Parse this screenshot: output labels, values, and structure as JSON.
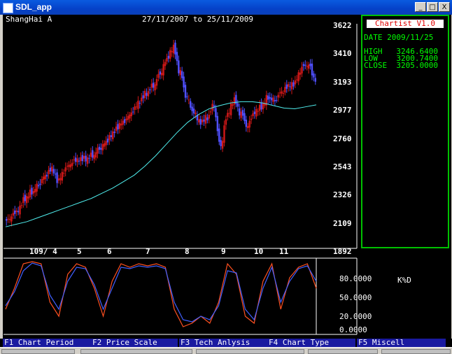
{
  "window": {
    "title": "SDL_app",
    "buttons": {
      "minimize": "_",
      "maximize": "□",
      "close": "X"
    }
  },
  "chart_header": {
    "symbol": "ShangHai A",
    "date_range": "27/11/2007 to 25/11/2009"
  },
  "info_panel": {
    "app_name": "Chartist V1.0",
    "date": "DATE 2009/11/25",
    "high": "HIGH   3246.6400",
    "low": "LOW    3200.7400",
    "close": "CLOSE  3205.0000"
  },
  "price_axis": [
    "3622",
    "3410",
    "3193",
    "2977",
    "2760",
    "2543",
    "2326",
    "2109",
    "1892"
  ],
  "month_labels": [
    "109/ 4",
    "5",
    "6",
    "7",
    "8",
    "9",
    "10",
    "11"
  ],
  "oscillator": {
    "levels": [
      "80.0000",
      "50.0000",
      "20.0000",
      "0.0000"
    ],
    "name": "K%D"
  },
  "function_keys": [
    "F1 Chart Period",
    "F2 Price Scale",
    "F3 Tech Anlysis",
    "F4 Chart Type",
    "F5 Miscell"
  ],
  "colors": {
    "up": "#d01818",
    "down": "#5050ff",
    "ma": "#50f0f0",
    "k_line": "#ff5020",
    "d_line": "#4060ff",
    "panel_border": "#00c000"
  },
  "chart_data": [
    {
      "type": "candlestick",
      "title": "ShangHai A",
      "xlabel": "",
      "ylabel": "",
      "ylim": [
        1892,
        3622
      ],
      "x_ticks": [
        "109/ 4",
        "5",
        "6",
        "7",
        "8",
        "9",
        "10",
        "11"
      ],
      "series": [
        {
          "name": "close",
          "values": [
            2140,
            2190,
            2290,
            2345,
            2400,
            2470,
            2520,
            2420,
            2510,
            2560,
            2590,
            2600,
            2630,
            2680,
            2730,
            2790,
            2850,
            2890,
            2960,
            3040,
            3110,
            3170,
            3260,
            3370,
            3460,
            3260,
            3060,
            2950,
            2880,
            2920,
            3020,
            2700,
            2940,
            3050,
            2940,
            2840,
            2950,
            3000,
            3080,
            3060,
            3120,
            3160,
            3180,
            3290,
            3320,
            3205
          ]
        },
        {
          "name": "moving average",
          "values": [
            2070,
            2090,
            2110,
            2140,
            2170,
            2200,
            2230,
            2260,
            2290,
            2330,
            2370,
            2420,
            2470,
            2540,
            2620,
            2710,
            2800,
            2880,
            2940,
            2985,
            3010,
            3030,
            3040,
            3040,
            3030,
            3010,
            2990,
            2985,
            3000,
            3015
          ]
        }
      ],
      "last_bar": {
        "date": "2009/11/25",
        "high": 3246.64,
        "low": 3200.74,
        "close": 3205.0
      }
    },
    {
      "type": "line",
      "title": "",
      "ylim": [
        0,
        100
      ],
      "y_ticks": [
        "80.0000",
        "50.0000",
        "20.0000",
        "0.0000"
      ],
      "series": [
        {
          "name": "K",
          "values": [
            30,
            60,
            95,
            98,
            95,
            40,
            20,
            80,
            95,
            90,
            60,
            20,
            70,
            95,
            90,
            95,
            92,
            95,
            90,
            30,
            5,
            10,
            20,
            10,
            40,
            95,
            80,
            20,
            10,
            70,
            95,
            30,
            75,
            90,
            95,
            60
          ]
        },
        {
          "name": "D",
          "values": [
            35,
            55,
            85,
            96,
            92,
            50,
            30,
            70,
            90,
            88,
            65,
            30,
            60,
            90,
            88,
            92,
            90,
            92,
            88,
            40,
            15,
            12,
            20,
            15,
            35,
            85,
            82,
            30,
            15,
            60,
            90,
            40,
            70,
            88,
            92,
            70
          ]
        }
      ]
    }
  ]
}
